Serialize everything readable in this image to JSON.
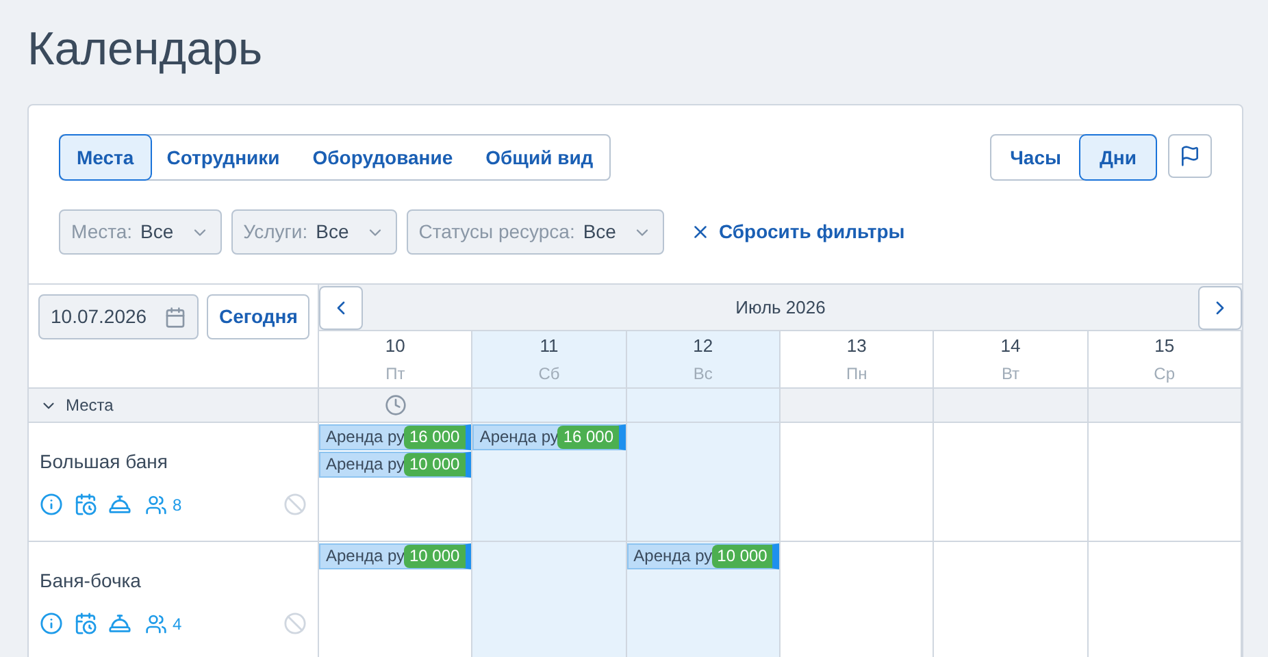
{
  "page_title": "Календарь",
  "view_tabs": [
    {
      "label": "Места",
      "selected": true
    },
    {
      "label": "Сотрудники",
      "selected": false
    },
    {
      "label": "Оборудование",
      "selected": false
    },
    {
      "label": "Общий вид",
      "selected": false
    }
  ],
  "scale_tabs": [
    {
      "label": "Часы",
      "selected": false
    },
    {
      "label": "Дни",
      "selected": true
    }
  ],
  "filters": [
    {
      "label": "Места:",
      "value": "Все"
    },
    {
      "label": "Услуги:",
      "value": "Все"
    },
    {
      "label": "Статусы ресурса:",
      "value": "Все"
    }
  ],
  "reset_filters": "Сбросить фильтры",
  "date_field": {
    "value": "10.07.2026"
  },
  "today_button": "Сегодня",
  "month": "Июль 2026",
  "days": [
    {
      "number": "10",
      "weekday": "Пт",
      "weekend": false,
      "marker": true
    },
    {
      "number": "11",
      "weekday": "Сб",
      "weekend": true,
      "marker": false
    },
    {
      "number": "12",
      "weekday": "Вс",
      "weekend": true,
      "marker": false
    },
    {
      "number": "13",
      "weekday": "Пн",
      "weekend": false,
      "marker": false
    },
    {
      "number": "14",
      "weekday": "Вт",
      "weekend": false,
      "marker": false
    },
    {
      "number": "15",
      "weekday": "Ср",
      "weekend": false,
      "marker": false
    }
  ],
  "group": {
    "label": "Места",
    "expanded": true
  },
  "resources": [
    {
      "name": "Большая баня",
      "capacity": "8",
      "cells": [
        [
          {
            "label": "Аренда ру",
            "price": "16 000"
          },
          {
            "label": "Аренда ру",
            "price": "10 000"
          }
        ],
        [
          {
            "label": "Аренда ру",
            "price": "16 000"
          }
        ],
        [],
        [],
        [],
        []
      ]
    },
    {
      "name": "Баня-бочка",
      "capacity": "4",
      "cells": [
        [
          {
            "label": "Аренда ру",
            "price": "10 000"
          }
        ],
        [],
        [
          {
            "label": "Аренда ру",
            "price": "10 000"
          }
        ],
        [],
        [],
        []
      ]
    }
  ]
}
